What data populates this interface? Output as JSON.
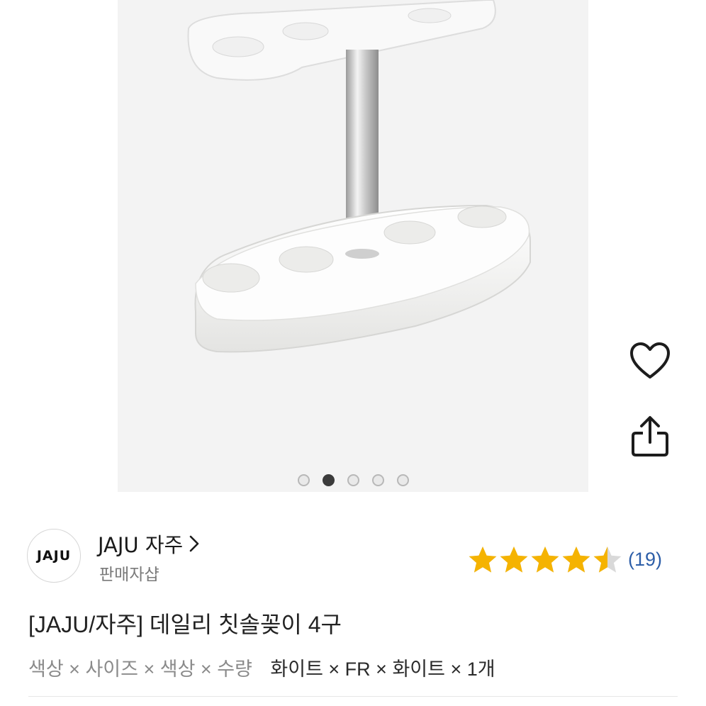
{
  "product_image": {
    "carousel_dots": [
      {
        "active": false
      },
      {
        "active": true
      },
      {
        "active": false
      },
      {
        "active": false
      },
      {
        "active": false
      }
    ]
  },
  "actions": {
    "favorite_icon": "heart-outline-icon",
    "share_icon": "share-icon"
  },
  "seller": {
    "logo_text": "JAJU",
    "name": "JAJU 자주",
    "chevron_icon": "chevron-right-icon",
    "subtitle": "판매자샵"
  },
  "rating": {
    "stars": 4.5,
    "max_stars": 5,
    "star_color": "#f5b301",
    "review_count": "(19)"
  },
  "product": {
    "title": "[JAJU/자주] 데일리 칫솔꽂이 4구",
    "option_keys": "색상 × 사이즈 × 색상 × 수량",
    "option_values": "화이트 × FR × 화이트 × 1개"
  }
}
